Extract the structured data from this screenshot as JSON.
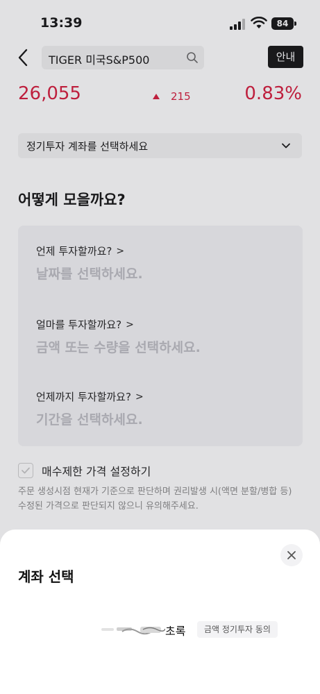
{
  "status_bar": {
    "time": "13:39",
    "battery": "84"
  },
  "header": {
    "search_text": "TIGER 미국S&P500",
    "guide_label": "안내"
  },
  "quote": {
    "price": "26,055",
    "change": "215",
    "change_rate": "0.83%",
    "up_color": "#d6193a"
  },
  "account_select": {
    "placeholder": "정기투자 계좌를 선택하세요"
  },
  "plan": {
    "title": "어떻게 모을까요?",
    "items": [
      {
        "question": "언제 투자할까요?",
        "answer": "날짜를 선택하세요."
      },
      {
        "question": "얼마를 투자할까요?",
        "answer": "금액 또는 수량을 선택하세요."
      },
      {
        "question": "언제까지 투자할까요?",
        "answer": "기간을 선택하세요."
      }
    ]
  },
  "limit": {
    "label": "매수제한 가격 설정하기",
    "note": "주문 생성시점 현재가 기준으로 판단하며 권리발생 시(액면 분할/병합 등) 수정된 가격으로 판단되지 않으니 유의해주세요."
  },
  "sheet": {
    "title": "계좌 선택",
    "accounts": [
      {
        "name": "초록",
        "badge": "금액 정기투자 동의"
      }
    ]
  },
  "icons": {
    "back": "chevron-left-icon",
    "search": "search-icon",
    "dropdown": "chevron-down-icon",
    "close": "close-icon",
    "check": "check-icon"
  }
}
